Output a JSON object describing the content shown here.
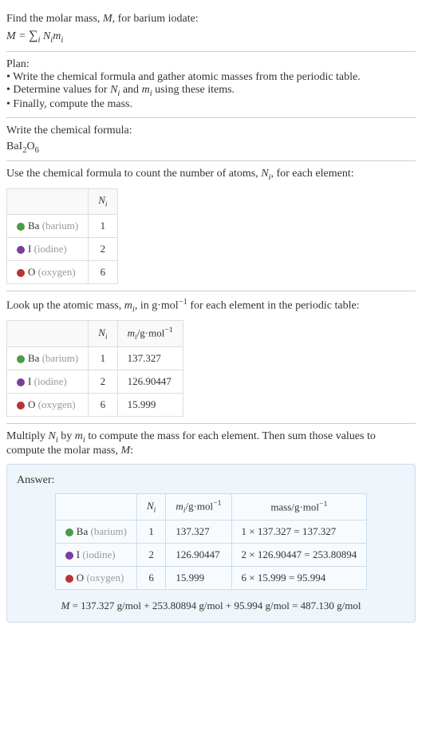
{
  "intro": {
    "line1": "Find the molar mass, ",
    "line1_var": "M",
    "line1_end": ", for barium iodate:",
    "formula_prefix": "M = ",
    "formula_sigma_sub": "i",
    "formula_end": " N",
    "formula_sub1": "i",
    "formula_mid": "m",
    "formula_sub2": "i"
  },
  "plan": {
    "title": "Plan:",
    "bullet1": "• Write the chemical formula and gather atomic masses from the periodic table.",
    "bullet2_start": "• Determine values for ",
    "bullet2_ni": "N",
    "bullet2_ni_sub": "i",
    "bullet2_mid": " and ",
    "bullet2_mi": "m",
    "bullet2_mi_sub": "i",
    "bullet2_end": " using these items.",
    "bullet3": "• Finally, compute the mass."
  },
  "chem_formula": {
    "title": "Write the chemical formula:",
    "formula": "BaI",
    "sub1": "2",
    "mid": "O",
    "sub2": "6"
  },
  "count_section": {
    "intro_start": "Use the chemical formula to count the number of atoms, ",
    "intro_var": "N",
    "intro_var_sub": "i",
    "intro_end": ", for each element:",
    "header_ni": "N",
    "header_ni_sub": "i",
    "rows": [
      {
        "dot": "dot-ba",
        "sym": "Ba",
        "name": "(barium)",
        "n": "1"
      },
      {
        "dot": "dot-i",
        "sym": "I",
        "name": "(iodine)",
        "n": "2"
      },
      {
        "dot": "dot-o",
        "sym": "O",
        "name": "(oxygen)",
        "n": "6"
      }
    ]
  },
  "mass_section": {
    "intro_start": "Look up the atomic mass, ",
    "intro_var": "m",
    "intro_var_sub": "i",
    "intro_mid": ", in g·mol",
    "intro_sup": "−1",
    "intro_end": " for each element in the periodic table:",
    "header_ni": "N",
    "header_ni_sub": "i",
    "header_mi": "m",
    "header_mi_sub": "i",
    "header_mi_unit": "/g·mol",
    "header_mi_sup": "−1",
    "rows": [
      {
        "dot": "dot-ba",
        "sym": "Ba",
        "name": "(barium)",
        "n": "1",
        "m": "137.327"
      },
      {
        "dot": "dot-i",
        "sym": "I",
        "name": "(iodine)",
        "n": "2",
        "m": "126.90447"
      },
      {
        "dot": "dot-o",
        "sym": "O",
        "name": "(oxygen)",
        "n": "6",
        "m": "15.999"
      }
    ]
  },
  "multiply_section": {
    "text_start": "Multiply ",
    "ni": "N",
    "ni_sub": "i",
    "mid": " by ",
    "mi": "m",
    "mi_sub": "i",
    "text_end": " to compute the mass for each element. Then sum those values to compute the molar mass, ",
    "mvar": "M",
    "colon": ":"
  },
  "answer": {
    "title": "Answer:",
    "header_ni": "N",
    "header_ni_sub": "i",
    "header_mi": "m",
    "header_mi_sub": "i",
    "header_mi_unit": "/g·mol",
    "header_mi_sup": "−1",
    "header_mass": "mass/g·mol",
    "header_mass_sup": "−1",
    "rows": [
      {
        "dot": "dot-ba",
        "sym": "Ba",
        "name": "(barium)",
        "n": "1",
        "m": "137.327",
        "calc": "1 × 137.327 = 137.327"
      },
      {
        "dot": "dot-i",
        "sym": "I",
        "name": "(iodine)",
        "n": "2",
        "m": "126.90447",
        "calc": "2 × 126.90447 = 253.80894"
      },
      {
        "dot": "dot-o",
        "sym": "O",
        "name": "(oxygen)",
        "n": "6",
        "m": "15.999",
        "calc": "6 × 15.999 = 95.994"
      }
    ],
    "final_var": "M",
    "final": " = 137.327 g/mol + 253.80894 g/mol + 95.994 g/mol = 487.130 g/mol"
  }
}
